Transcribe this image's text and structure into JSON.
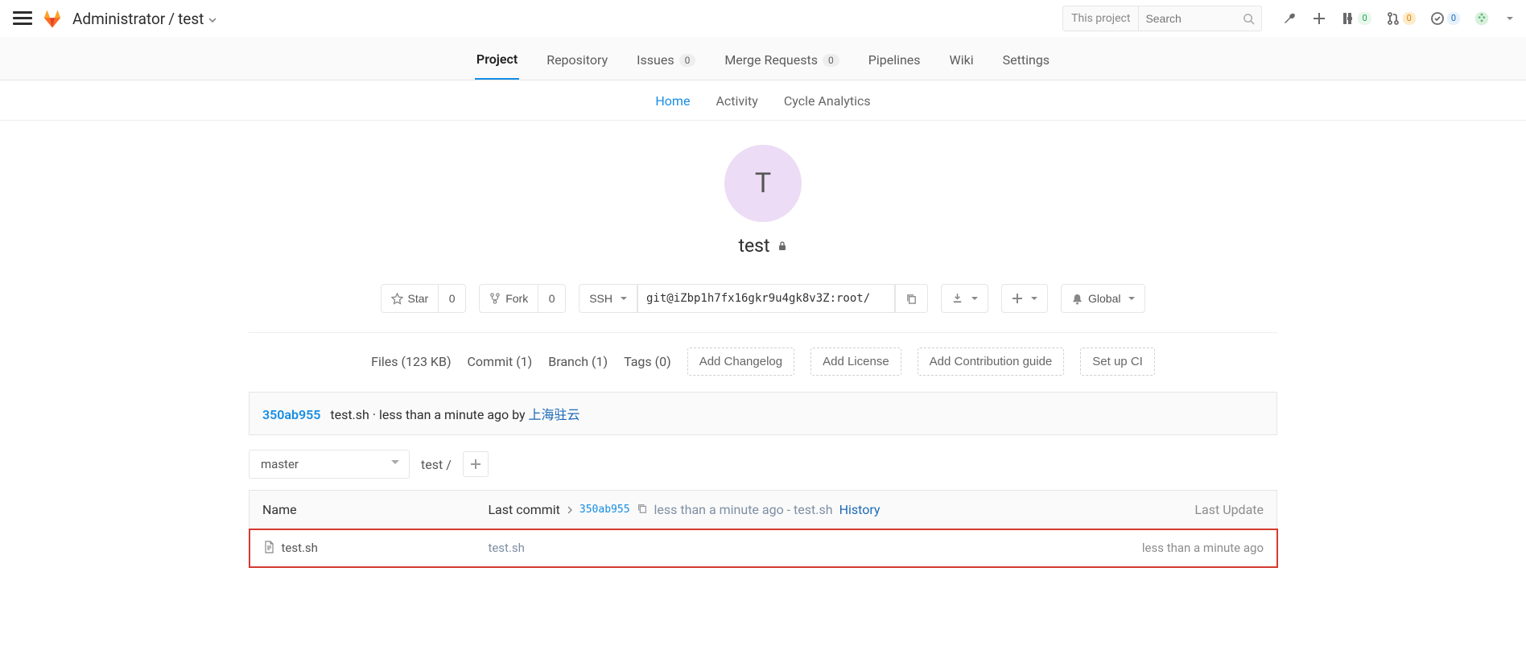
{
  "header": {
    "breadcrumb_owner": "Administrator",
    "breadcrumb_sep": "/",
    "breadcrumb_project": "test",
    "search_scope": "This project",
    "search_placeholder": "Search",
    "issues_count": "0",
    "mr_count": "0",
    "todos_count": "0"
  },
  "main_tabs": {
    "project": "Project",
    "repository": "Repository",
    "issues": "Issues",
    "issues_count": "0",
    "merge_requests": "Merge Requests",
    "merge_requests_count": "0",
    "pipelines": "Pipelines",
    "wiki": "Wiki",
    "settings": "Settings"
  },
  "sub_tabs": {
    "home": "Home",
    "activity": "Activity",
    "cycle": "Cycle Analytics"
  },
  "project": {
    "avatar_letter": "T",
    "name": "test"
  },
  "actions": {
    "star": "Star",
    "star_count": "0",
    "fork": "Fork",
    "fork_count": "0",
    "protocol": "SSH",
    "clone_url": "git@iZbp1h7fx16gkr9u4gk8v3Z:root/",
    "notification": "Global"
  },
  "stats": {
    "files": "Files (123 KB)",
    "commit": "Commit (1)",
    "branch": "Branch (1)",
    "tags": "Tags (0)",
    "add_changelog": "Add Changelog",
    "add_license": "Add License",
    "add_contrib": "Add Contribution guide",
    "setup_ci": "Set up CI"
  },
  "last_commit": {
    "sha": "350ab955",
    "message": "test.sh",
    "sep": "·",
    "time": "less than a minute ago by",
    "author": "上海驻云"
  },
  "branch": {
    "selected": "master",
    "path_root": "test",
    "path_sep": "/"
  },
  "table": {
    "header_name": "Name",
    "header_last_commit": "Last commit",
    "header_sha": "350ab955",
    "header_time_msg": "less than a minute ago - test.sh",
    "header_history": "History",
    "header_last_update": "Last Update",
    "row": {
      "name": "test.sh",
      "commit_msg": "test.sh",
      "updated": "less than a minute ago"
    }
  }
}
